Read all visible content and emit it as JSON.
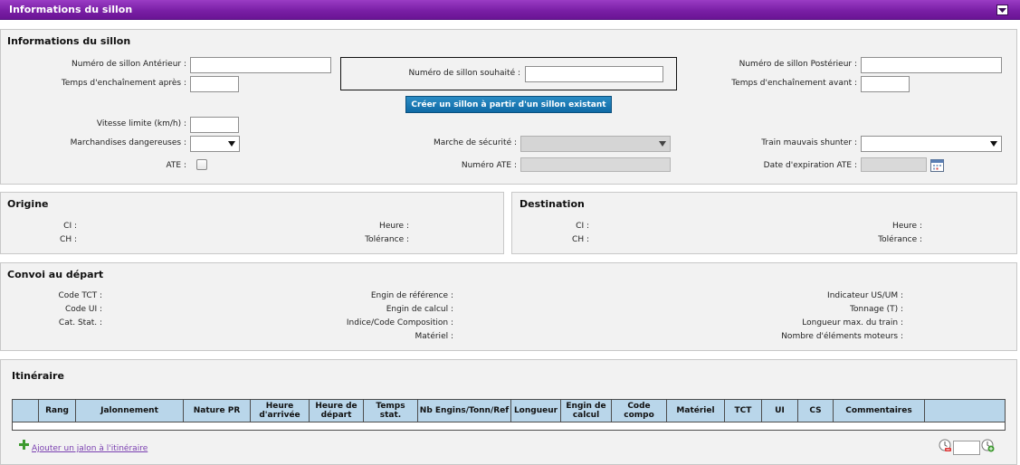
{
  "header": {
    "title": "Informations du sillon"
  },
  "info": {
    "title": "Informations du sillon",
    "numero_anterieur": "Numéro de sillon Antérieur :",
    "temps_apres": "Temps d'enchaînement après :",
    "numero_souhaite": "Numéro de sillon souhaité :",
    "numero_posterieur": "Numéro de sillon Postérieur :",
    "temps_avant": "Temps d'enchaînement avant :",
    "create_button": "Créer un sillon à partir d'un sillon existant",
    "vitesse": "Vitesse limite (km/h) :",
    "marchandises": "Marchandises dangereuses :",
    "marche_securite": "Marche de sécurité :",
    "train_shunter": "Train mauvais shunter :",
    "ate": "ATE :",
    "numero_ate": "Numéro ATE :",
    "date_ate": "Date d'expiration ATE :"
  },
  "origine": {
    "title": "Origine",
    "ci": "CI :",
    "ch": "CH :",
    "heure": "Heure :",
    "tolerance": "Tolérance :"
  },
  "destination": {
    "title": "Destination",
    "ci": "CI :",
    "ch": "CH :",
    "heure": "Heure :",
    "tolerance": "Tolérance :"
  },
  "convoi": {
    "title": "Convoi au départ",
    "code_tct": "Code TCT :",
    "code_ui": "Code UI :",
    "cat_stat": "Cat. Stat. :",
    "engin_ref": "Engin de référence :",
    "engin_calcul": "Engin de calcul :",
    "indice": "Indice/Code Composition :",
    "materiel": "Matériel :",
    "indicateur": "Indicateur US/UM :",
    "tonnage": "Tonnage (T) :",
    "longueur_max": "Longueur max. du train :",
    "nb_moteurs": "Nombre d'éléments moteurs :"
  },
  "itineraire": {
    "title": "Itinéraire",
    "columns": [
      "",
      "Rang",
      "Jalonnement",
      "Nature PR",
      "Heure d'arrivée",
      "Heure de départ",
      "Temps stat.",
      "Nb Engins/Tonn/Ref",
      "Longueur",
      "Engin de calcul",
      "Code compo",
      "Matériel",
      "TCT",
      "UI",
      "CS",
      "Commentaires",
      ""
    ],
    "add_link": "Ajouter un jalon à l'itinéraire"
  },
  "icons": {
    "collapse": "chevron-down-icon",
    "calendar": "calendar-icon",
    "add": "plus-icon",
    "prev": "clock-minus-icon",
    "next": "clock-plus-icon"
  },
  "colors": {
    "title_bar": "#7a1fa6",
    "button": "#1677b5",
    "table_header": "#b9d6ea",
    "link": "#7a3fb0"
  }
}
